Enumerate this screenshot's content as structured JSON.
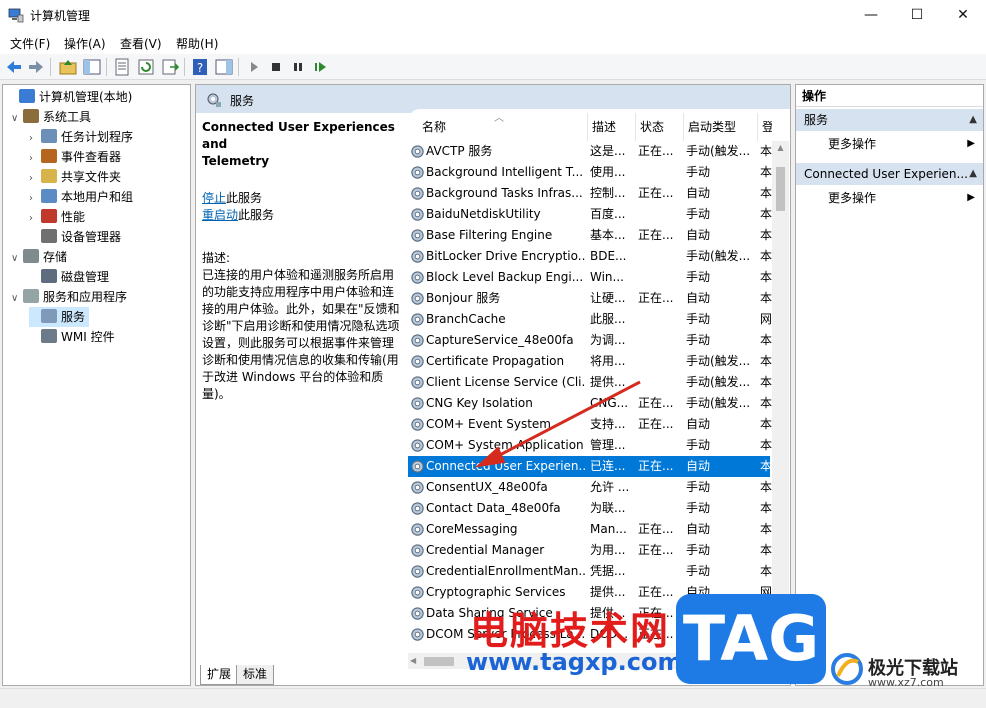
{
  "window": {
    "title": "计算机管理"
  },
  "menu": [
    "文件(F)",
    "操作(A)",
    "查看(V)",
    "帮助(H)"
  ],
  "tree": [
    {
      "label": "计算机管理(本地)",
      "level": 0,
      "chev": "",
      "icon": "computer-management-icon"
    },
    {
      "label": "系统工具",
      "level": 1,
      "chev": "∨",
      "icon": "tools-icon"
    },
    {
      "label": "任务计划程序",
      "level": 2,
      "chev": "›",
      "icon": "clock-icon"
    },
    {
      "label": "事件查看器",
      "level": 2,
      "chev": "›",
      "icon": "event-viewer-icon"
    },
    {
      "label": "共享文件夹",
      "level": 2,
      "chev": "›",
      "icon": "shared-folder-icon"
    },
    {
      "label": "本地用户和组",
      "level": 2,
      "chev": "›",
      "icon": "users-icon"
    },
    {
      "label": "性能",
      "level": 2,
      "chev": "›",
      "icon": "performance-icon"
    },
    {
      "label": "设备管理器",
      "level": 2,
      "chev": "",
      "icon": "device-manager-icon"
    },
    {
      "label": "存储",
      "level": 1,
      "chev": "∨",
      "icon": "storage-icon"
    },
    {
      "label": "磁盘管理",
      "level": 2,
      "chev": "",
      "icon": "disk-icon"
    },
    {
      "label": "服务和应用程序",
      "level": 1,
      "chev": "∨",
      "icon": "services-apps-icon"
    },
    {
      "label": "服务",
      "level": 2,
      "chev": "",
      "icon": "services-icon",
      "selected": true
    },
    {
      "label": "WMI 控件",
      "level": 2,
      "chev": "",
      "icon": "wmi-icon"
    }
  ],
  "center": {
    "header": "服务",
    "desc_title_line1": "Connected User Experiences and",
    "desc_title_line2": "Telemetry",
    "stop_link": "停止",
    "stop_suffix": "此服务",
    "restart_link": "重启动",
    "restart_suffix": "此服务",
    "desc_label": "描述:",
    "desc_lines": [
      "已连接的用户体验和遥测服务所启用",
      "的功能支持应用程序中用户体验和连",
      "接的用户体验。此外，如果在\"反馈和",
      "诊断\"下启用诊断和使用情况隐私选项",
      "设置，则此服务可以根据事件来管理",
      "诊断和使用情况信息的收集和传输(用",
      "于改进 Windows 平台的体验和质",
      "量)。"
    ],
    "columns": [
      "名称",
      "描述",
      "状态",
      "启动类型",
      "登"
    ],
    "tabs": [
      "扩展",
      "标准"
    ]
  },
  "services": [
    {
      "name": "AVCTP 服务",
      "desc": "这是...",
      "status": "正在...",
      "startup": "手动(触发...",
      "logon": "本"
    },
    {
      "name": "Background Intelligent T...",
      "desc": "使用...",
      "status": "",
      "startup": "手动",
      "logon": "本"
    },
    {
      "name": "Background Tasks Infras...",
      "desc": "控制...",
      "status": "正在...",
      "startup": "自动",
      "logon": "本"
    },
    {
      "name": "BaiduNetdiskUtility",
      "desc": "百度...",
      "status": "",
      "startup": "手动",
      "logon": "本"
    },
    {
      "name": "Base Filtering Engine",
      "desc": "基本...",
      "status": "正在...",
      "startup": "自动",
      "logon": "本"
    },
    {
      "name": "BitLocker Drive Encryptio...",
      "desc": "BDE...",
      "status": "",
      "startup": "手动(触发...",
      "logon": "本"
    },
    {
      "name": "Block Level Backup Engi...",
      "desc": "Win...",
      "status": "",
      "startup": "手动",
      "logon": "本"
    },
    {
      "name": "Bonjour 服务",
      "desc": "让硬...",
      "status": "正在...",
      "startup": "自动",
      "logon": "本"
    },
    {
      "name": "BranchCache",
      "desc": "此服...",
      "status": "",
      "startup": "手动",
      "logon": "网"
    },
    {
      "name": "CaptureService_48e00fa",
      "desc": "为调...",
      "status": "",
      "startup": "手动",
      "logon": "本"
    },
    {
      "name": "Certificate Propagation",
      "desc": "将用...",
      "status": "",
      "startup": "手动(触发...",
      "logon": "本"
    },
    {
      "name": "Client License Service (Cli...",
      "desc": "提供...",
      "status": "",
      "startup": "手动(触发...",
      "logon": "本"
    },
    {
      "name": "CNG Key Isolation",
      "desc": "CNG...",
      "status": "正在...",
      "startup": "手动(触发...",
      "logon": "本"
    },
    {
      "name": "COM+ Event System",
      "desc": "支持...",
      "status": "正在...",
      "startup": "自动",
      "logon": "本"
    },
    {
      "name": "COM+ System Application",
      "desc": "管理...",
      "status": "",
      "startup": "手动",
      "logon": "本"
    },
    {
      "name": "Connected User Experien...",
      "desc": "已连...",
      "status": "正在...",
      "startup": "自动",
      "logon": "本",
      "selected": true
    },
    {
      "name": "ConsentUX_48e00fa",
      "desc": "允许 ...",
      "status": "",
      "startup": "手动",
      "logon": "本"
    },
    {
      "name": "Contact Data_48e00fa",
      "desc": "为联...",
      "status": "",
      "startup": "手动",
      "logon": "本"
    },
    {
      "name": "CoreMessaging",
      "desc": "Man...",
      "status": "正在...",
      "startup": "自动",
      "logon": "本"
    },
    {
      "name": "Credential Manager",
      "desc": "为用...",
      "status": "正在...",
      "startup": "手动",
      "logon": "本"
    },
    {
      "name": "CredentialEnrollmentMan...",
      "desc": "凭据...",
      "status": "",
      "startup": "手动",
      "logon": "本"
    },
    {
      "name": "Cryptographic Services",
      "desc": "提供...",
      "status": "正在...",
      "startup": "自动",
      "logon": "网"
    },
    {
      "name": "Data Sharing Service",
      "desc": "提供...",
      "status": "正在...",
      "startup": "手动(触发...",
      "logon": "本"
    },
    {
      "name": "DCOM Server Process La...",
      "desc": "DCO...",
      "status": "正在...",
      "startup": "自动",
      "logon": "本"
    }
  ],
  "actions": {
    "title": "操作",
    "group1": "服务",
    "group1_more": "更多操作",
    "group2": "Connected User Experien...",
    "group2_more": "更多操作"
  },
  "watermark": {
    "red_text": "电脑技术网",
    "url": "www.tagxp.com",
    "tag": "TAG",
    "logo_text": "极光下载站",
    "logo_url": "www.xz7.com"
  },
  "colors": {
    "selection": "#0078d7",
    "header_band": "#d6e2f0",
    "link": "#0063b1",
    "annotation_arrow": "#d42b1e"
  }
}
